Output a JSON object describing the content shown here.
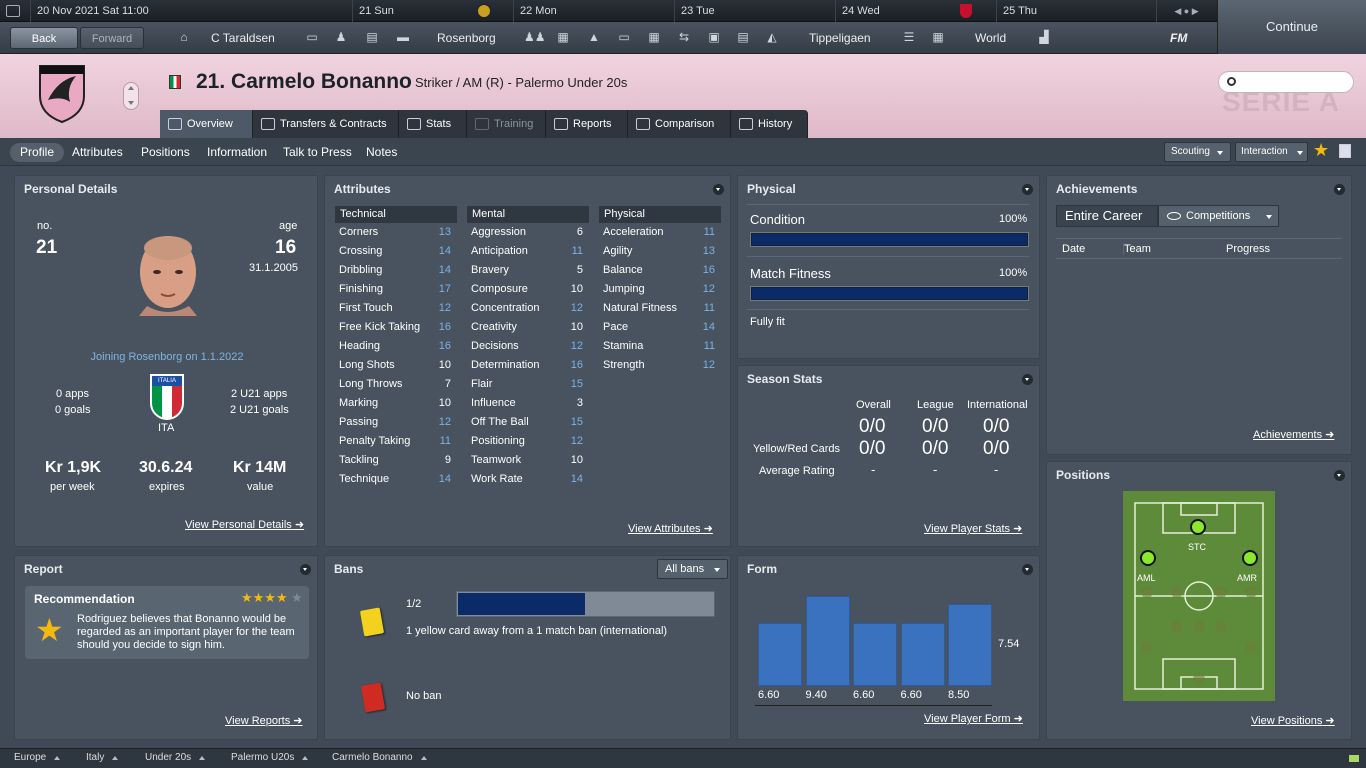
{
  "topbar": {
    "date": "20 Nov 2021 Sat  11:00",
    "days": [
      "21 Sun",
      "22 Mon",
      "23 Tue",
      "24 Wed",
      "25 Thu"
    ]
  },
  "toolbar": {
    "back": "Back",
    "forward": "Forward",
    "manager": "C Taraldsen",
    "club": "Rosenborg",
    "league": "Tippeligaen",
    "world": "World",
    "fm": "FM",
    "continue": "Continue"
  },
  "player": {
    "title": "21. Carmelo Bonanno",
    "role": "Striker / AM (R) - Palermo Under 20s"
  },
  "header": {
    "watermark": "SERIE A"
  },
  "tabs": [
    "Overview",
    "Transfers & Contracts",
    "Stats",
    "Training",
    "Reports",
    "Comparison",
    "History"
  ],
  "subnav": {
    "items": [
      "Profile",
      "Attributes",
      "Positions",
      "Information",
      "Talk to Press",
      "Notes"
    ],
    "scouting": "Scouting",
    "interaction": "Interaction"
  },
  "personal": {
    "title": "Personal Details",
    "no_label": "no.",
    "no": "21",
    "age_label": "age",
    "age": "16",
    "dob": "31.1.2005",
    "joining": "Joining Rosenborg on 1.1.2022",
    "apps": "0 apps",
    "goals": "0 goals",
    "nation": "ITA",
    "flag_text": "ITALIA",
    "u21_apps": "2 U21 apps",
    "u21_goals": "2 U21 goals",
    "wage": "Kr 1,9K",
    "wage_label": "per week",
    "expires": "30.6.24",
    "expires_label": "expires",
    "value": "Kr 14M",
    "value_label": "value",
    "link": "View Personal Details"
  },
  "attributes": {
    "title": "Attributes",
    "technical_title": "Technical",
    "mental_title": "Mental",
    "physical_title": "Physical",
    "technical": [
      {
        "name": "Corners",
        "value": "13",
        "hl": true
      },
      {
        "name": "Crossing",
        "value": "14",
        "hl": true
      },
      {
        "name": "Dribbling",
        "value": "14",
        "hl": true
      },
      {
        "name": "Finishing",
        "value": "17",
        "hl": true
      },
      {
        "name": "First Touch",
        "value": "12",
        "hl": true
      },
      {
        "name": "Free Kick Taking",
        "value": "16",
        "hl": true
      },
      {
        "name": "Heading",
        "value": "16",
        "hl": true
      },
      {
        "name": "Long Shots",
        "value": "10",
        "hl": false
      },
      {
        "name": "Long Throws",
        "value": "7",
        "hl": false
      },
      {
        "name": "Marking",
        "value": "10",
        "hl": false
      },
      {
        "name": "Passing",
        "value": "12",
        "hl": true
      },
      {
        "name": "Penalty Taking",
        "value": "11",
        "hl": true
      },
      {
        "name": "Tackling",
        "value": "9",
        "hl": false
      },
      {
        "name": "Technique",
        "value": "14",
        "hl": true
      }
    ],
    "mental": [
      {
        "name": "Aggression",
        "value": "6",
        "hl": false
      },
      {
        "name": "Anticipation",
        "value": "11",
        "hl": true
      },
      {
        "name": "Bravery",
        "value": "5",
        "hl": false
      },
      {
        "name": "Composure",
        "value": "10",
        "hl": false
      },
      {
        "name": "Concentration",
        "value": "12",
        "hl": true
      },
      {
        "name": "Creativity",
        "value": "10",
        "hl": false
      },
      {
        "name": "Decisions",
        "value": "12",
        "hl": true
      },
      {
        "name": "Determination",
        "value": "16",
        "hl": true
      },
      {
        "name": "Flair",
        "value": "15",
        "hl": true
      },
      {
        "name": "Influence",
        "value": "3",
        "hl": false
      },
      {
        "name": "Off The Ball",
        "value": "15",
        "hl": true
      },
      {
        "name": "Positioning",
        "value": "12",
        "hl": true
      },
      {
        "name": "Teamwork",
        "value": "10",
        "hl": false
      },
      {
        "name": "Work Rate",
        "value": "14",
        "hl": true
      }
    ],
    "physical": [
      {
        "name": "Acceleration",
        "value": "11",
        "hl": true
      },
      {
        "name": "Agility",
        "value": "13",
        "hl": true
      },
      {
        "name": "Balance",
        "value": "16",
        "hl": true
      },
      {
        "name": "Jumping",
        "value": "12",
        "hl": true
      },
      {
        "name": "Natural Fitness",
        "value": "11",
        "hl": true
      },
      {
        "name": "Pace",
        "value": "14",
        "hl": true
      },
      {
        "name": "Stamina",
        "value": "11",
        "hl": true
      },
      {
        "name": "Strength",
        "value": "12",
        "hl": true
      }
    ],
    "link": "View Attributes"
  },
  "physical": {
    "title": "Physical",
    "condition_label": "Condition",
    "condition": "100%",
    "condition_level": 1.0,
    "fitness_label": "Match Fitness",
    "fitness": "100%",
    "fitness_level": 1.0,
    "status": "Fully fit"
  },
  "season": {
    "title": "Season Stats",
    "cols": [
      "Overall",
      "League",
      "International"
    ],
    "cards_label": "Yellow/Red Cards",
    "rating_label": "Average Rating",
    "row1": [
      "0/0",
      "0/0",
      "0/0"
    ],
    "row2": [
      "0/0",
      "0/0",
      "0/0"
    ],
    "row3": [
      "-",
      "-",
      "-"
    ],
    "link": "View Player Stats"
  },
  "achievements": {
    "title": "Achievements",
    "entire_career": "Entire Career",
    "competitions": "Competitions",
    "cols": [
      "Date",
      "Team",
      "Progress"
    ],
    "link": "Achievements"
  },
  "positions": {
    "title": "Positions",
    "stc": "STC",
    "aml": "AML",
    "amr": "AMR",
    "link": "View Positions"
  },
  "report": {
    "title": "Report",
    "rec_title": "Recommendation",
    "stars": "★★★★",
    "text": "Rodriguez believes that Bonanno would be regarded as an important player for the team should you decide to sign him.",
    "link": "View Reports"
  },
  "bans": {
    "title": "Bans",
    "filter": "All bans",
    "count": "1/2",
    "progress": 0.5,
    "yellow_text": "1 yellow card away from a 1 match ban (international)",
    "red_text": "No ban"
  },
  "form": {
    "title": "Form",
    "average": "7.54",
    "link": "View Player Form",
    "values": [
      6.6,
      9.4,
      6.6,
      6.6,
      8.5
    ],
    "labels": [
      "6.60",
      "9.40",
      "6.60",
      "6.60",
      "8.50"
    ]
  },
  "footer": {
    "items": [
      "Europe",
      "Italy",
      "Under 20s",
      "Palermo U20s",
      "Carmelo Bonanno"
    ]
  },
  "colors": {
    "header_pink": "#e8c7d4",
    "panel": "#48535f",
    "highlight_value": "#79b3e6",
    "bar_fill": "#0a2a68",
    "form_bar": "#3b72bf",
    "pitch": "#5e8b3a",
    "position_dot": "#8be82d"
  }
}
